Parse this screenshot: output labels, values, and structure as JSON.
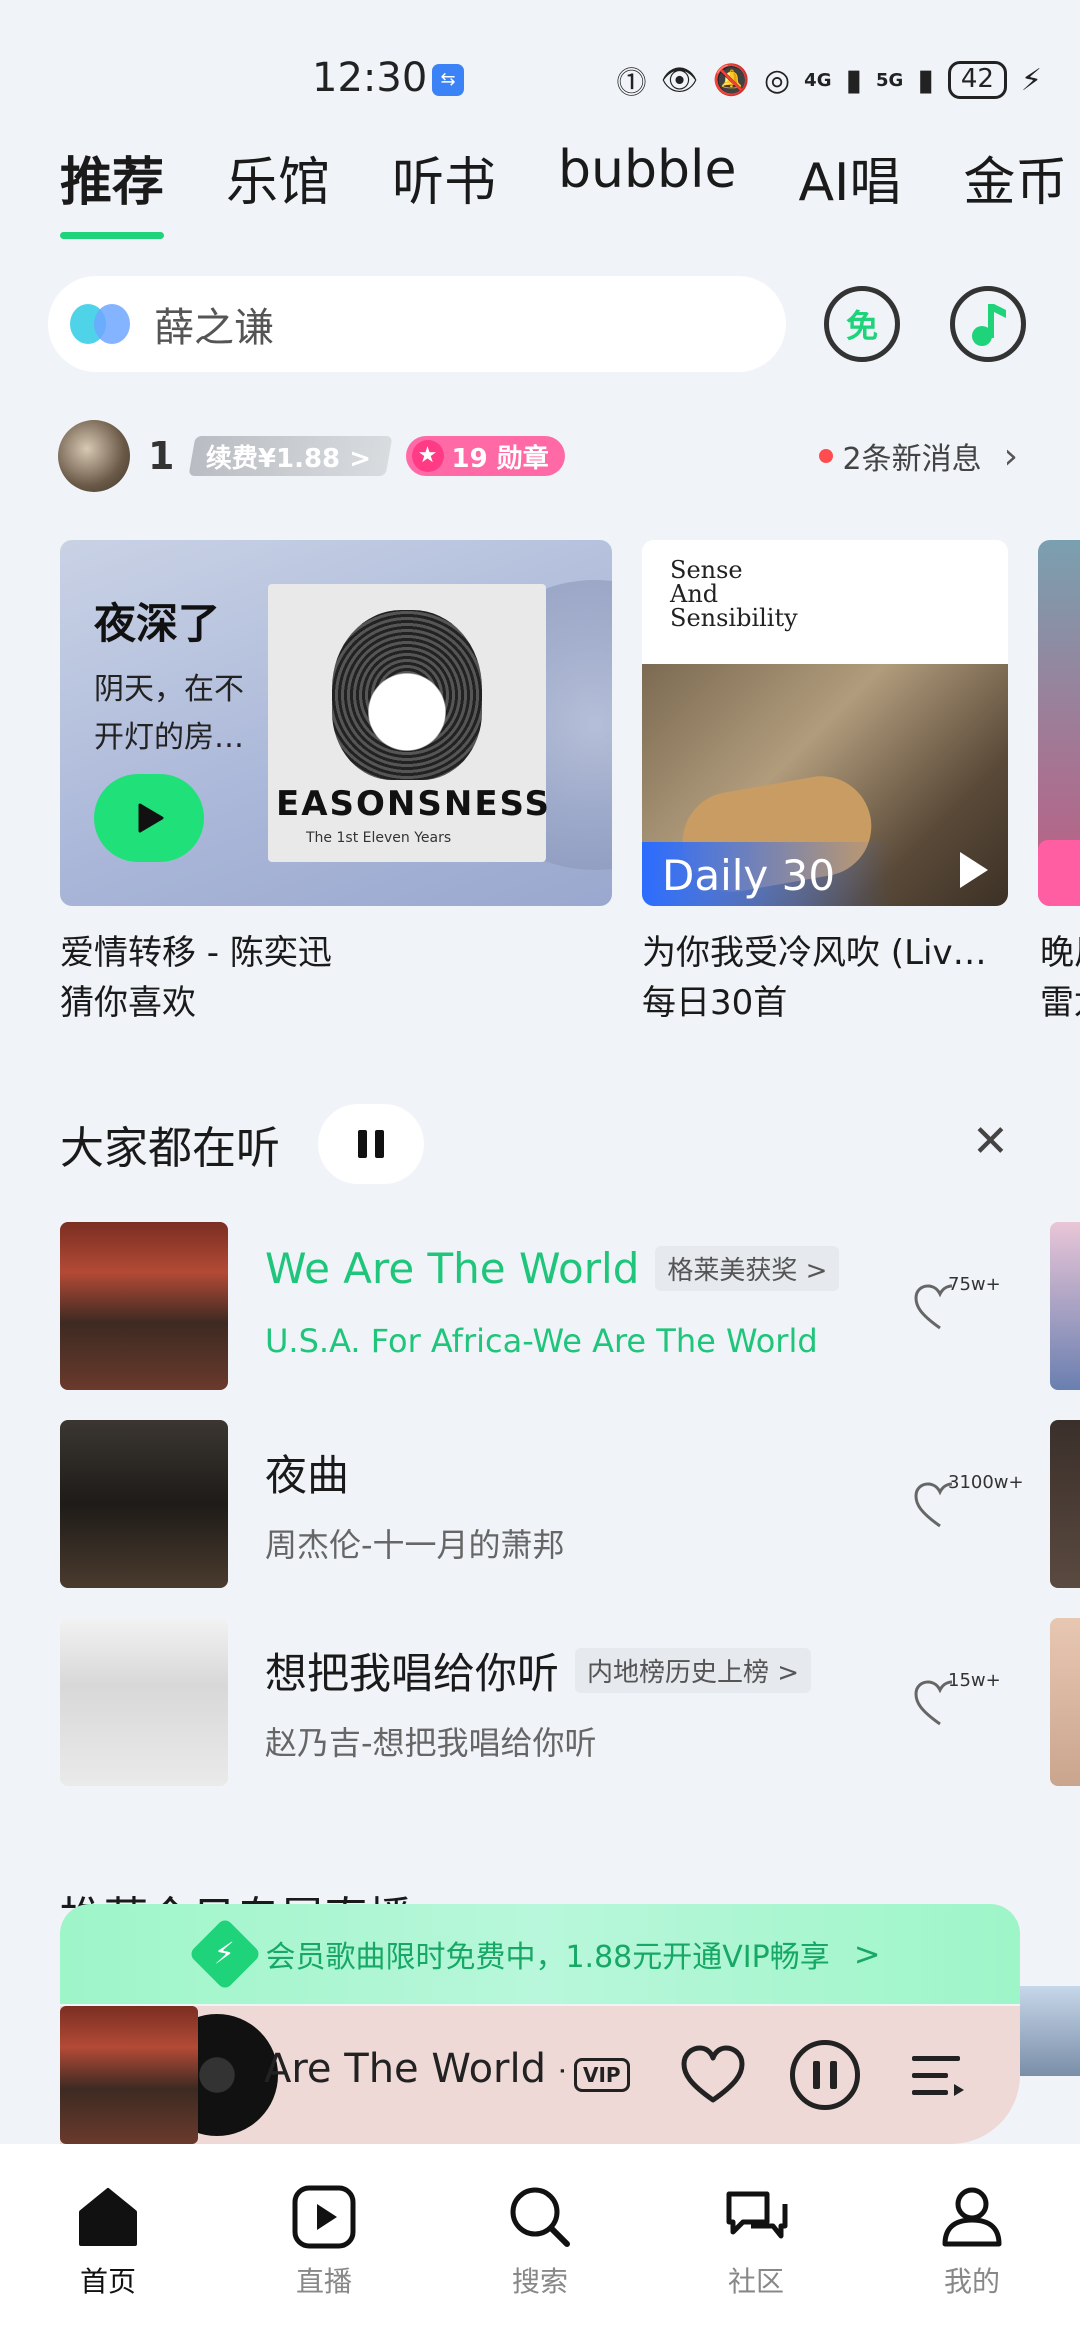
{
  "status_bar": {
    "time": "12:30",
    "battery": "42",
    "sig1": "4G",
    "sig2": "5G"
  },
  "top_tabs": [
    "推荐",
    "乐馆",
    "听书",
    "bubble",
    "AI唱",
    "金币"
  ],
  "search": {
    "placeholder": "薛之谦",
    "free_label": "免"
  },
  "user": {
    "level": "1",
    "renew_label": "续费¥1.88 >",
    "medal_label": "19 勋章",
    "messages": "2条新消息"
  },
  "cards": [
    {
      "title": "夜深了",
      "desc": "阴天，在不开灯的房…",
      "cover_title": "EASONSNESS",
      "cover_sub": "The 1st Eleven Years",
      "caption1": "爱情转移 - 陈奕迅",
      "caption2": "猜你喜欢"
    },
    {
      "cover_title": "Sense\nAnd\nSensibility",
      "label": "Daily 30",
      "caption1": "为你我受冷风吹 (Liv…",
      "caption2": "每日30首"
    },
    {
      "caption1": "晚风",
      "caption2": "雷龙"
    }
  ],
  "section1": {
    "title": "大家都在听"
  },
  "songs": [
    {
      "name": "We Are The World",
      "tag": "格莱美获奖 >",
      "sub": "U.S.A. For Africa-We Are The World",
      "likes": "75w+"
    },
    {
      "name": "夜曲",
      "tag": "",
      "sub": "周杰伦-十一月的萧邦",
      "likes": "3100w+"
    },
    {
      "name": "想把我唱给你听",
      "tag": "内地榜历史上榜 >",
      "sub": "赵乃吉-想把我唱给你听",
      "likes": "15w+"
    }
  ],
  "section2": {
    "title": "推荐今日专属直播"
  },
  "vip_banner": {
    "text": "会员歌曲限时免费中，1.88元开通VIP畅享",
    "arrow": ">"
  },
  "mini_player": {
    "title": "Are The World - U.S.A.",
    "vip": "VIP"
  },
  "bottom_nav": [
    "首页",
    "直播",
    "搜索",
    "社区",
    "我的"
  ],
  "colors": {
    "accent": "#1ed37a",
    "playing": "#1fc57b",
    "medal": "#ff6aa6"
  }
}
